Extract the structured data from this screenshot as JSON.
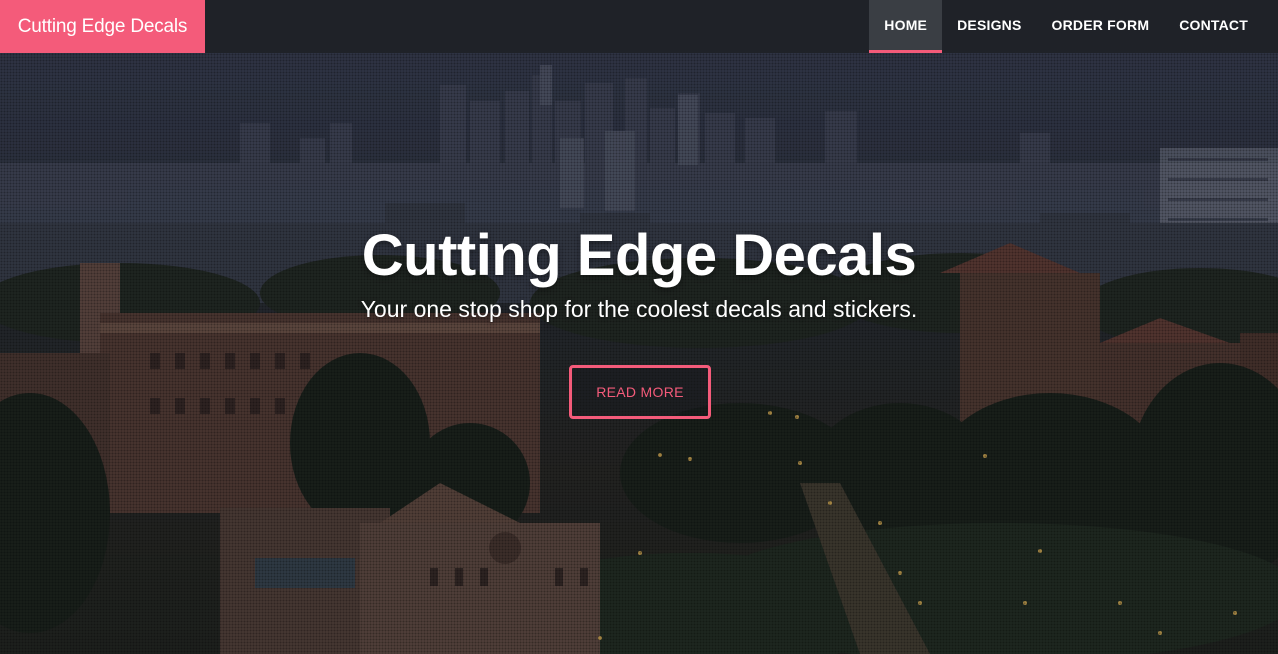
{
  "navbar": {
    "brand": "Cutting Edge Decals",
    "items": [
      {
        "label": "HOME",
        "active": true
      },
      {
        "label": "DESIGNS",
        "active": false
      },
      {
        "label": "ORDER FORM",
        "active": false
      },
      {
        "label": "CONTACT",
        "active": false
      }
    ]
  },
  "hero": {
    "title": "Cutting Edge Decals",
    "subtitle": "Your one stop shop for the coolest decals and stickers.",
    "cta_label": "READ MORE"
  },
  "colors": {
    "accent": "#f45b7a",
    "navbar_bg": "#1f2228",
    "nav_active_bg": "#3a3e44",
    "text": "#ffffff"
  }
}
